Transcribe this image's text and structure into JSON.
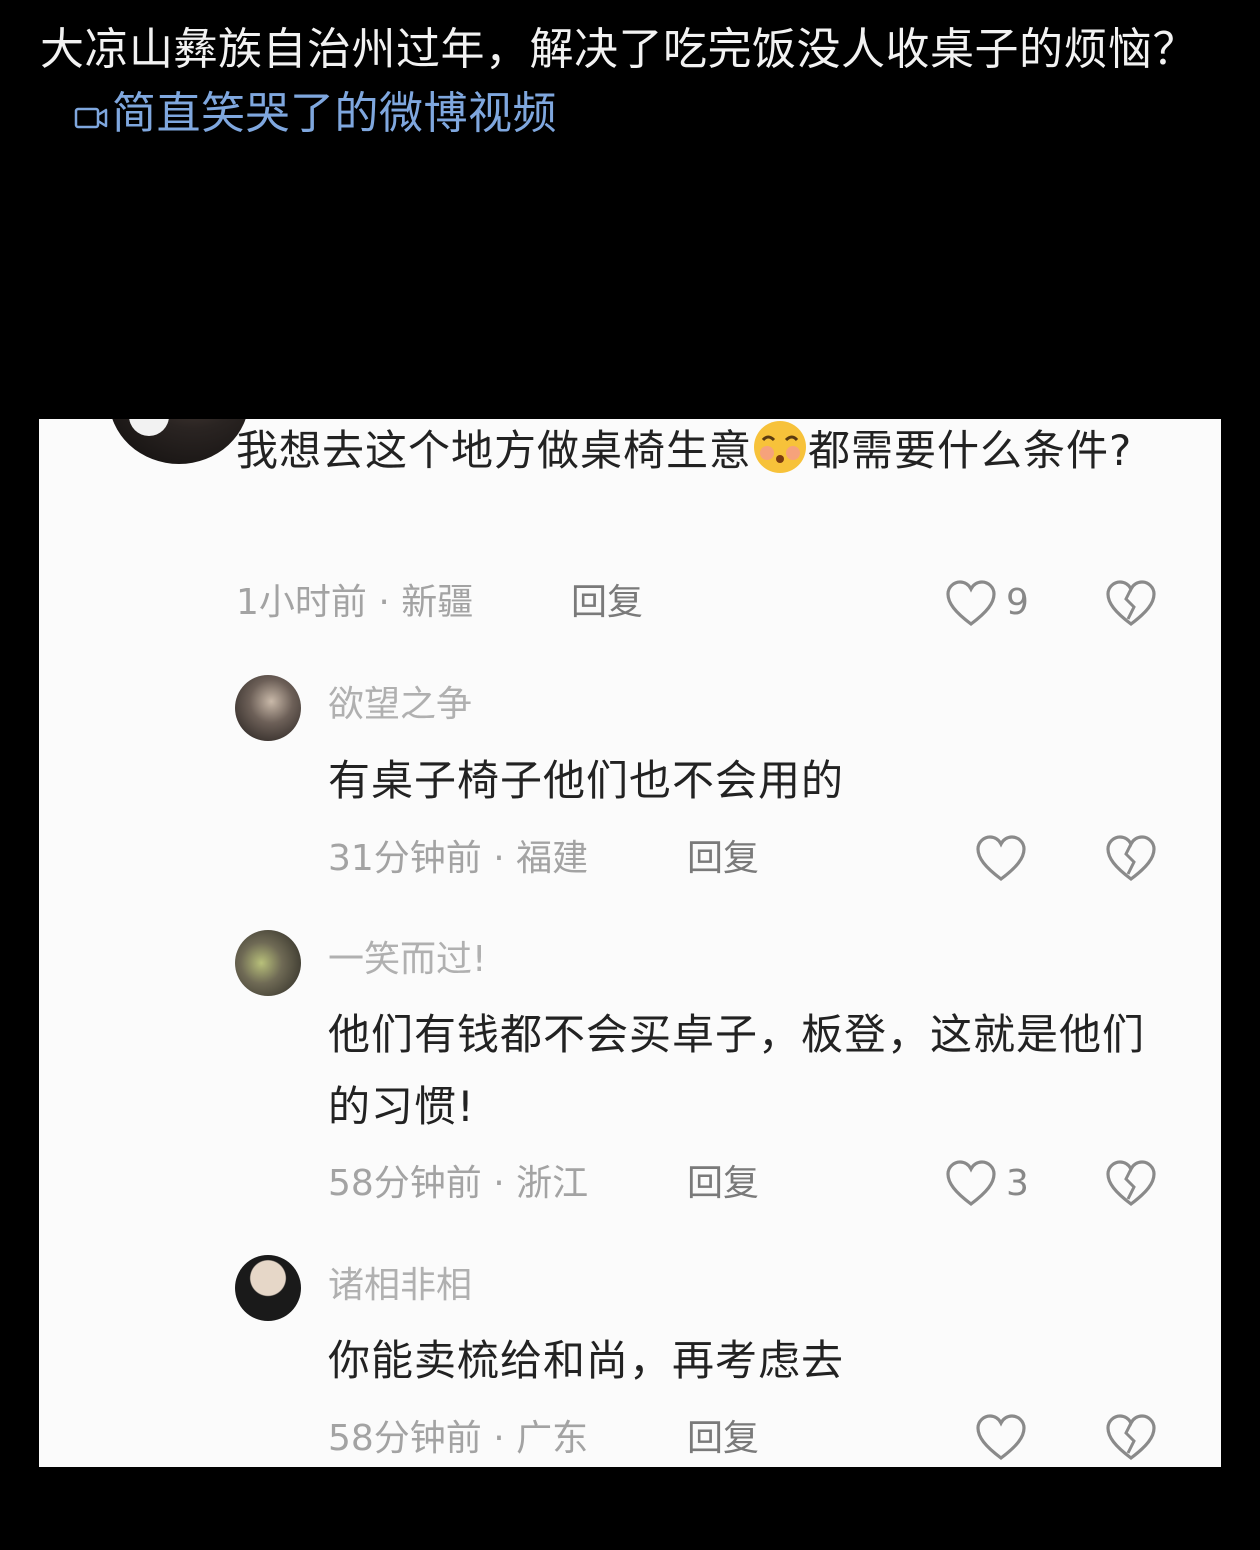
{
  "post": {
    "title": "大凉山彝族自治州过年，解决了吃完饭没人收桌子的烦恼？",
    "video_link_label": "简直笑哭了的微博视频"
  },
  "comments": {
    "top": {
      "text_before_emoji": "我想去这个地方做桌椅生意",
      "text_after_emoji": "都需要什么条件?",
      "time_location": "1小时前 · 新疆",
      "reply_label": "回复",
      "likes": "9"
    },
    "replies": [
      {
        "username": "欲望之争",
        "text": "有桌子椅子他们也不会用的",
        "time_location": "31分钟前 · 福建",
        "reply_label": "回复",
        "likes": ""
      },
      {
        "username": "一笑而过!",
        "text": "他们有钱都不会买卓子，板登，这就是他们的习惯!",
        "time_location": "58分钟前 · 浙江",
        "reply_label": "回复",
        "likes": "3"
      },
      {
        "username": "诸相非相",
        "text": "你能卖梳给和尚，再考虑去",
        "time_location": "58分钟前 · 广东",
        "reply_label": "回复",
        "likes": ""
      }
    ]
  },
  "icons": {
    "video": "video-camera-icon",
    "like": "heart-icon",
    "dislike": "broken-heart-icon",
    "emoji": "blushing-face-emoji"
  },
  "colors": {
    "page_background": "#000000",
    "title_text": "#f2f2f2",
    "link": "#7fa7de",
    "card_background": "#fbfbfb",
    "comment_text": "#222222",
    "meta_text": "#a3a3a3"
  }
}
